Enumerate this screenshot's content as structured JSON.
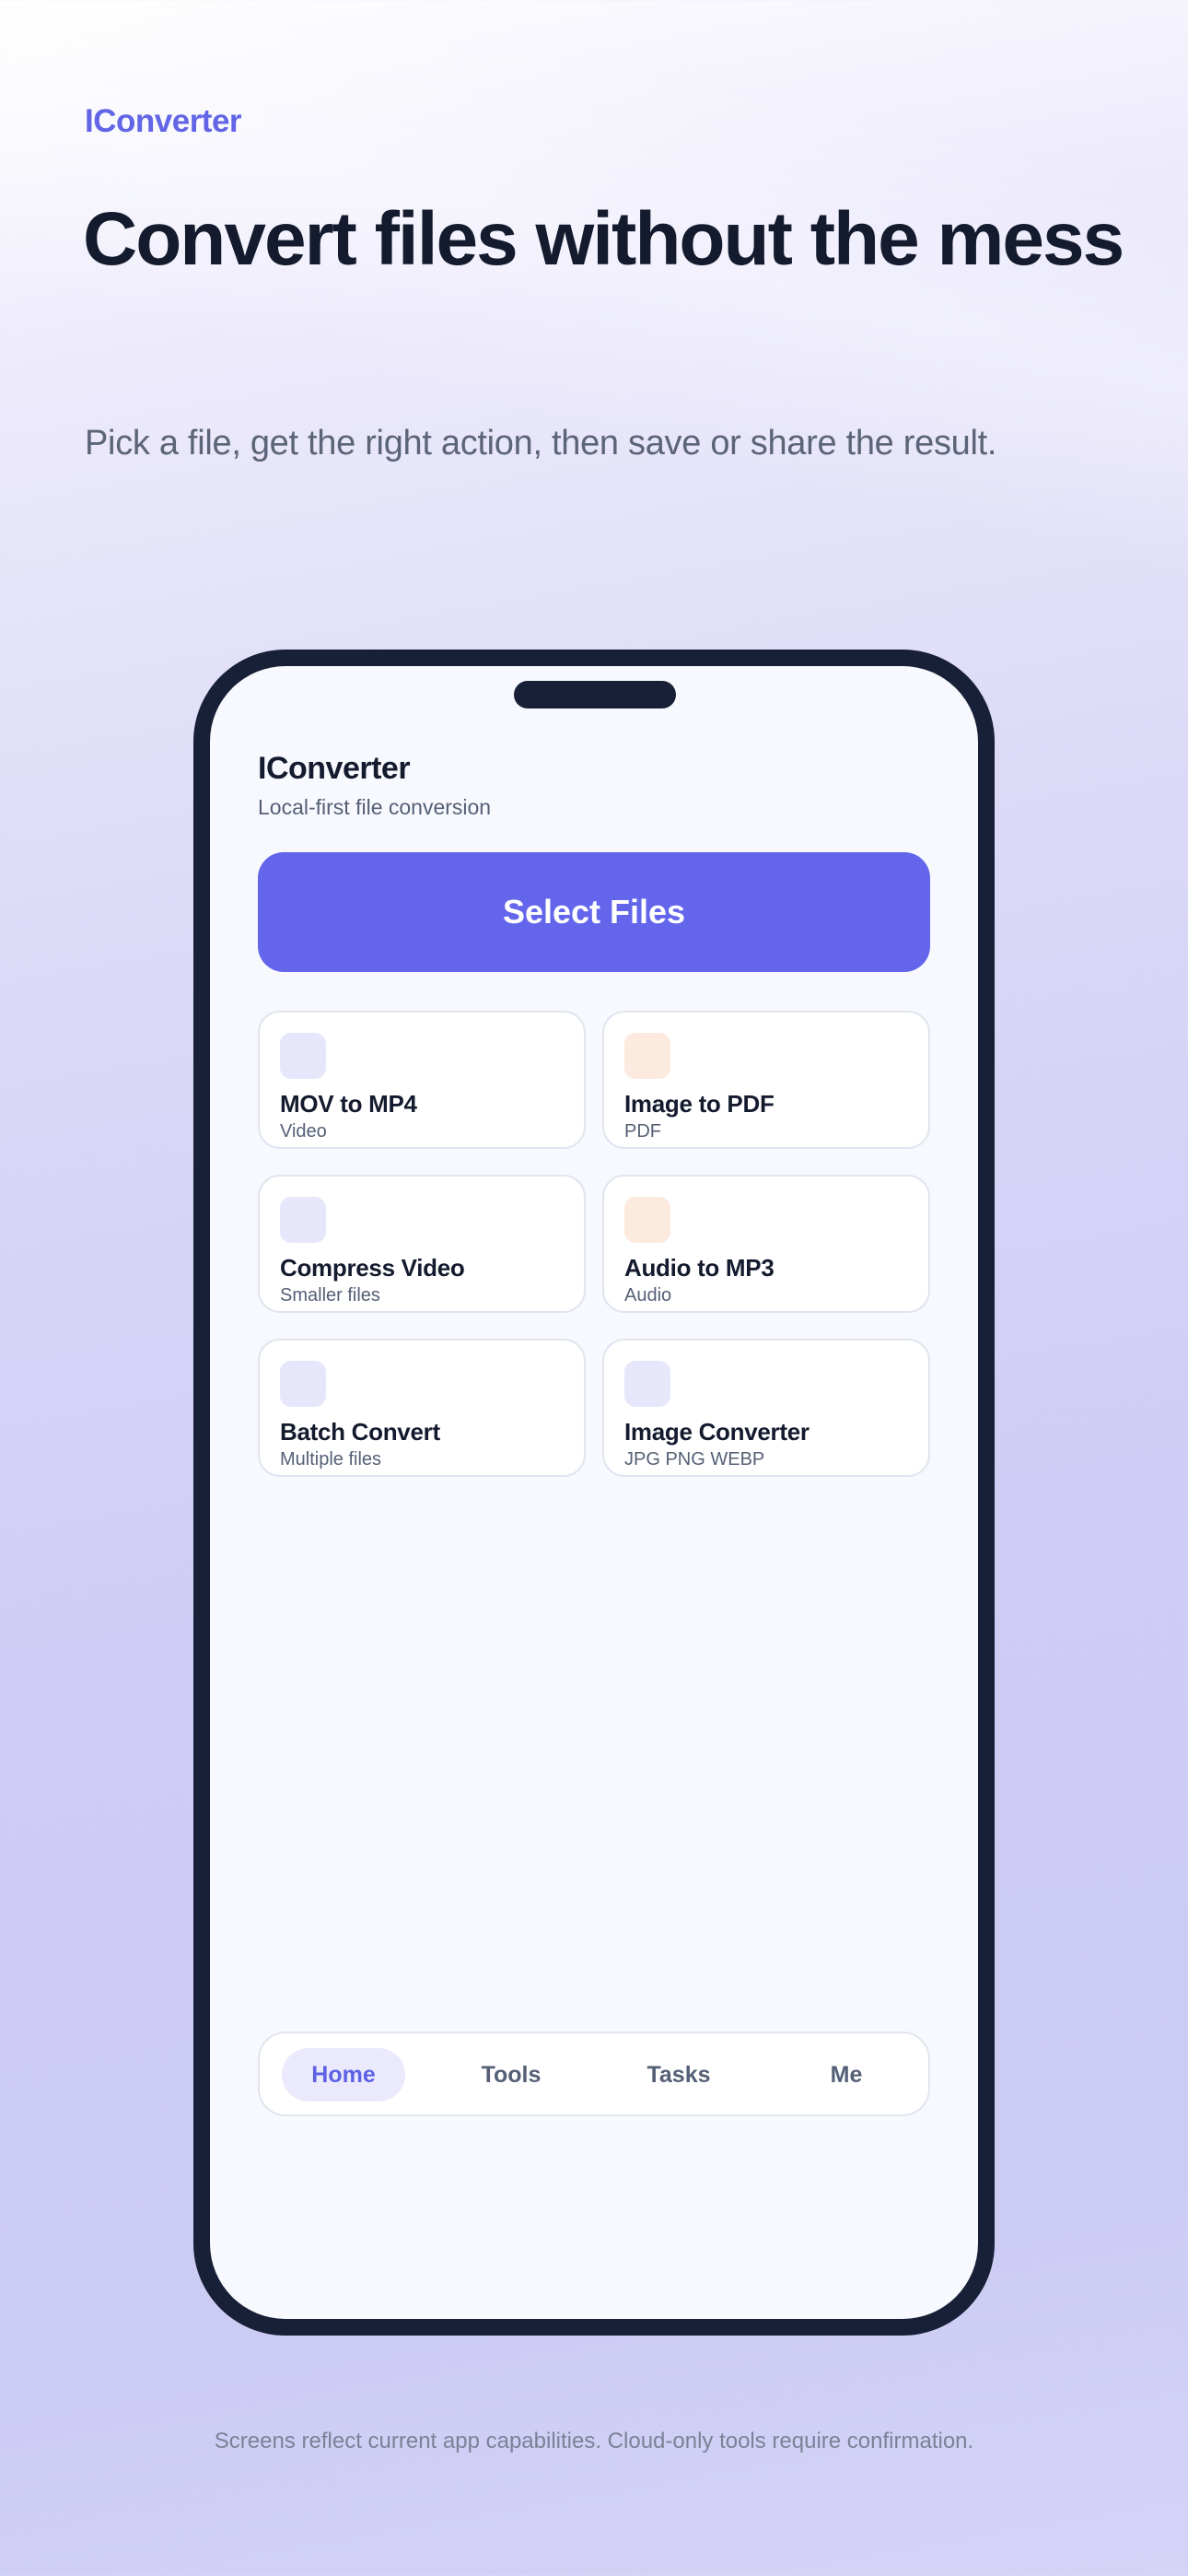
{
  "page": {
    "brand": "IConverter",
    "headline": "Convert files without the mess",
    "subheadline": "Pick a file, get the right action, then save or share the result.",
    "footer_note": "Screens reflect current app capabilities. Cloud-only tools require confirmation."
  },
  "app": {
    "title": "IConverter",
    "subtitle": "Local-first file conversion",
    "select_button": "Select Files",
    "tools": [
      {
        "title": "MOV to MP4",
        "subtitle": "Video",
        "icon_color": "#e6e7fb"
      },
      {
        "title": "Image to PDF",
        "subtitle": "PDF",
        "icon_color": "#fdeadf"
      },
      {
        "title": "Compress Video",
        "subtitle": "Smaller files",
        "icon_color": "#e6e7fb"
      },
      {
        "title": "Audio to MP3",
        "subtitle": "Audio",
        "icon_color": "#fdeadf"
      },
      {
        "title": "Batch Convert",
        "subtitle": "Multiple files",
        "icon_color": "#e6e7fb"
      },
      {
        "title": "Image Converter",
        "subtitle": "JPG PNG WEBP",
        "icon_color": "#e6e7fb"
      }
    ],
    "tabs": [
      {
        "label": "Home",
        "active": true
      },
      {
        "label": "Tools",
        "active": false
      },
      {
        "label": "Tasks",
        "active": false
      },
      {
        "label": "Me",
        "active": false
      }
    ]
  },
  "colors": {
    "accent": "#6366eb",
    "heading": "#141b2e",
    "muted": "#5b6478",
    "phone_frame": "#172036"
  }
}
